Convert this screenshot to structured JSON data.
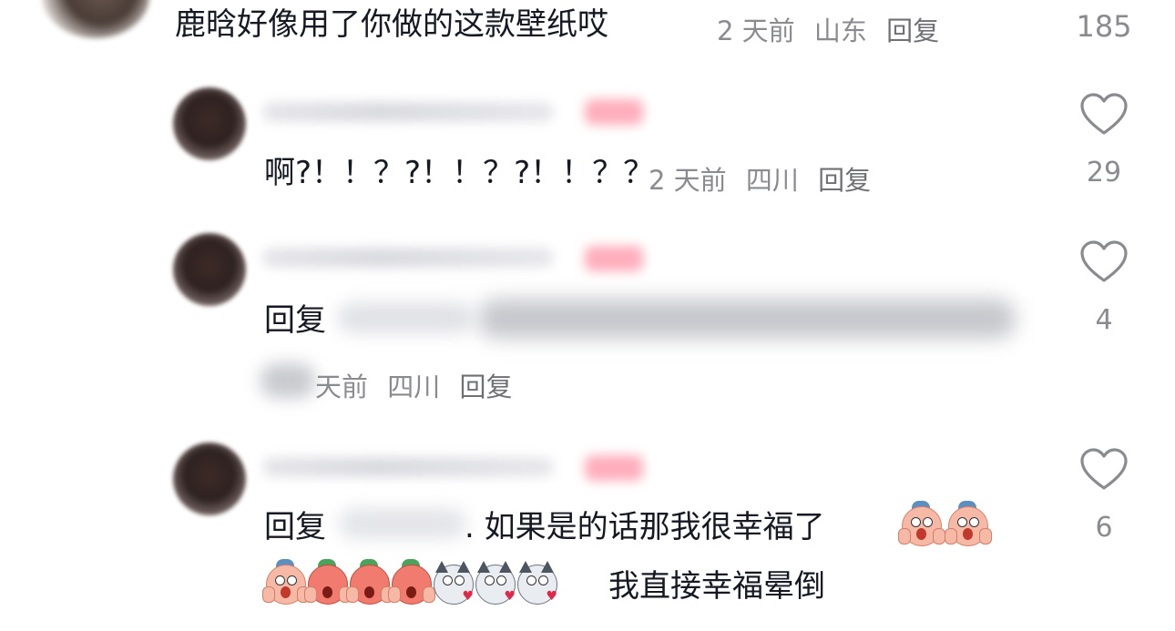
{
  "top_comment": {
    "text": "鹿晗好像用了你做的这款壁纸哎",
    "time": "2 天前",
    "location": "山东",
    "reply_label": "回复",
    "like_count": "185"
  },
  "replies": [
    {
      "text": "啊?！！？?！！？?！！？？",
      "time": "2 天前",
      "location": "四川",
      "reply_label": "回复",
      "like_count": "29"
    },
    {
      "prefix": "回复",
      "time_partial": "天前",
      "location": "四川",
      "reply_label": "回复",
      "like_count": "4"
    },
    {
      "prefix": "回复",
      "text": ". 如果是的话那我很幸福了",
      "text2": "我直接幸福晕倒",
      "like_count": "6"
    }
  ],
  "icons": {
    "like": "heart-outline-icon",
    "emoji_scream": "scream-face-emoji",
    "emoji_angry": "angry-face-emoji",
    "emoji_husky": "husky-love-emoji"
  },
  "colors": {
    "text": "#161823",
    "meta": "#8a8b91",
    "badge_blur": "#ff9fb0"
  }
}
